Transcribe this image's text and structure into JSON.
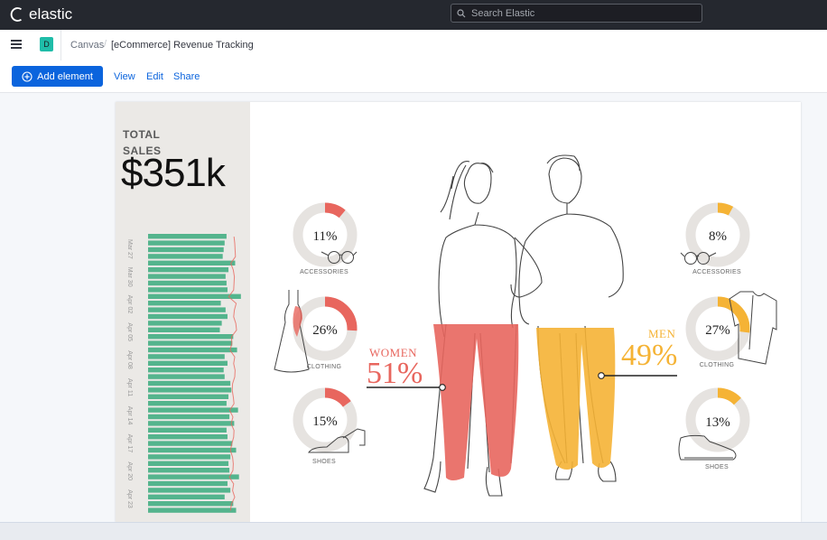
{
  "header": {
    "brand": "elastic",
    "search_placeholder": "Search Elastic"
  },
  "nav": {
    "space_initial": "D",
    "breadcrumbs": [
      "Canvas",
      "[eCommerce] Revenue Tracking"
    ]
  },
  "toolbar": {
    "add_element": "Add element",
    "view": "View",
    "edit": "Edit",
    "share": "Share"
  },
  "workpad": {
    "total_label": "TOTAL SALES",
    "total_value": "$351k",
    "women": {
      "label": "WOMEN",
      "percent": "51%"
    },
    "men": {
      "label": "MEN",
      "percent": "49%"
    },
    "women_categories": [
      {
        "pct": "11%",
        "label": "ACCESSORIES",
        "value": 0.11
      },
      {
        "pct": "26%",
        "label": "CLOTHING",
        "value": 0.26
      },
      {
        "pct": "15%",
        "label": "SHOES",
        "value": 0.15
      }
    ],
    "men_categories": [
      {
        "pct": "8%",
        "label": "ACCESSORIES",
        "value": 0.08
      },
      {
        "pct": "27%",
        "label": "CLOTHING",
        "value": 0.27
      },
      {
        "pct": "13%",
        "label": "SHOES",
        "value": 0.13
      }
    ],
    "colors": {
      "women": "#e8665e",
      "men": "#f5b335",
      "bar": "#54b48d",
      "donut_track": "#e6e3e0"
    }
  },
  "chart_data": {
    "type": "bar",
    "categories": [
      "Mar 27",
      "Mar 30",
      "Apr 02",
      "Apr 05",
      "Apr 08",
      "Apr 11",
      "Apr 14",
      "Apr 17",
      "Apr 20",
      "Apr 23"
    ],
    "values": [
      82,
      80,
      79,
      78,
      91,
      84,
      81,
      82,
      83,
      97,
      76,
      81,
      83,
      77,
      75,
      89,
      88,
      93,
      80,
      83,
      79,
      80,
      86,
      87,
      84,
      82,
      94,
      85,
      90,
      82,
      83,
      88,
      92,
      86,
      84,
      85,
      95,
      83,
      86,
      80,
      89,
      92
    ]
  }
}
